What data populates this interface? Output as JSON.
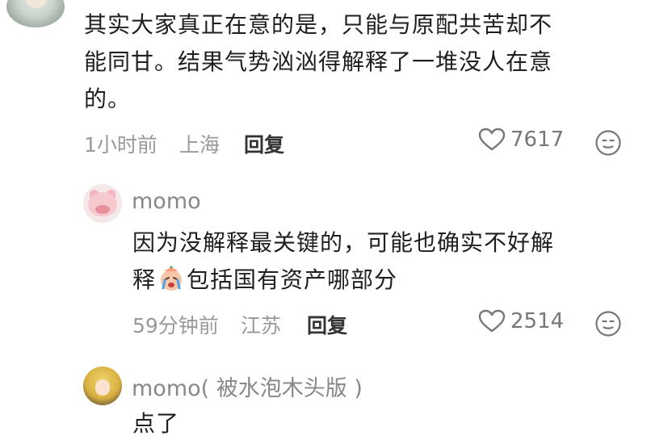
{
  "top_comment": {
    "text_line1": "其实大家真正在意的是，只能与原配共苦却不",
    "text_line2": "能同甘。结果气势汹汹得解释了一堆没人在意",
    "text_line3": "的。",
    "time": "1小时前",
    "location": "上海",
    "reply_label": "回复",
    "likes": "7617",
    "icons": {
      "like": "heart-outline-icon",
      "react": "smiley-icon"
    }
  },
  "reply1": {
    "username": "momo",
    "text_line1": "因为没解释最关键的，可能也确实不好解",
    "text_line2_prefix": "释",
    "text_line2_suffix": "包括国有资产哪部分",
    "inline_emoji": "crying-face-emoji",
    "time": "59分钟前",
    "location": "江苏",
    "reply_label": "回复",
    "likes": "2514"
  },
  "reply2": {
    "username": "momo( 被水泡木头版 )",
    "text": "点了"
  },
  "colors": {
    "text": "#1f1f1f",
    "meta": "#999999",
    "username": "#888888"
  }
}
